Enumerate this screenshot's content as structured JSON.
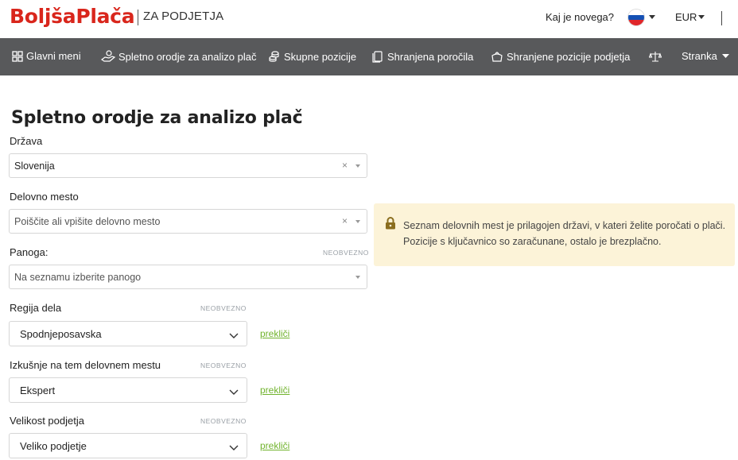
{
  "header": {
    "brand": "BoljšaPlača",
    "brand_sub": "ZA PODJETJA",
    "whats_new": "Kaj je novega?",
    "currency": "EUR",
    "flag_icon": "slovenia-flag-icon"
  },
  "nav": {
    "items": [
      {
        "label": "Glavni meni",
        "icon": "grid-icon"
      },
      {
        "label": "Spletno orodje za analizo plač",
        "icon": "hand-coin-icon"
      },
      {
        "label": "Skupne pozicije",
        "icon": "coins-icon"
      },
      {
        "label": "Shranjena poročila",
        "icon": "documents-icon"
      },
      {
        "label": "Shranjene pozicije podjetja",
        "icon": "bag-icon"
      },
      {
        "label": "",
        "icon": "scales-icon"
      },
      {
        "label": "Stranka",
        "icon": "chevron-down-icon"
      }
    ]
  },
  "main": {
    "title": "Spletno orodje za analizo plač",
    "optional_tag": "NEOBVEZNO",
    "cancel_label": "prekliči",
    "country": {
      "label": "Država",
      "value": "Slovenija"
    },
    "position": {
      "label": "Delovno mesto",
      "placeholder": "Poiščite ali vpišite delovno mesto"
    },
    "industry": {
      "label": "Panoga:",
      "placeholder": "Na seznamu izberite panogo"
    },
    "region": {
      "label": "Regija dela",
      "value": "Spodnjeposavska"
    },
    "experience": {
      "label": "Izkušnje na tem delovnem mestu",
      "value": "Ekspert"
    },
    "company_size": {
      "label": "Velikost podjetja",
      "value": "Veliko podjetje"
    }
  },
  "info": {
    "text": "Seznam delovnih mest je prilagojen državi, v kateri želite poročati o plači. Pozicije s ključavnico so zaračunane, ostalo je brezplačno."
  },
  "colors": {
    "brand": "#d9261c",
    "navbar": "#58595b",
    "link": "#71b32e",
    "info_bg": "#fcf3d8",
    "lock": "#8a6d1e"
  }
}
